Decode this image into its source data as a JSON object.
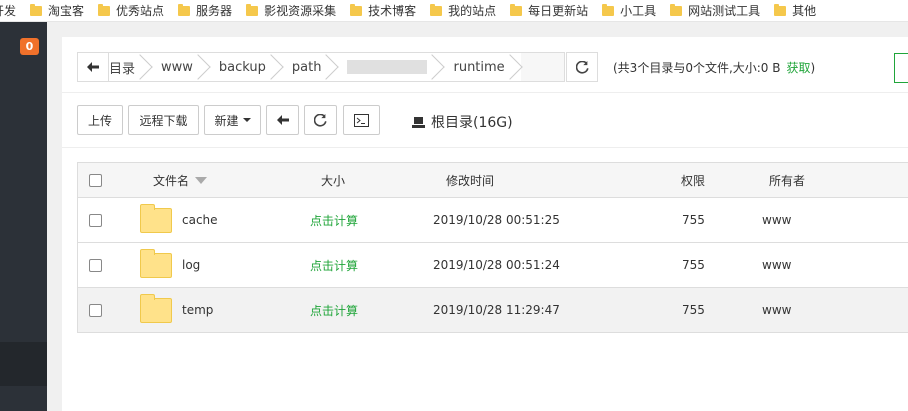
{
  "bookmarks": [
    "开发",
    "淘宝客",
    "优秀站点",
    "服务器",
    "影视资源采集",
    "技术博客",
    "我的站点",
    "每日更新站",
    "小工具",
    "网站测试工具",
    "其他"
  ],
  "sidebar": {
    "badge": "0"
  },
  "path": {
    "crumbs": [
      "目录",
      "www",
      "backup",
      "path",
      "runtime"
    ],
    "summary": "(共3个目录与0个文件,大小:0 B",
    "calc_link": "获取",
    "summary_close": ")"
  },
  "toolbar": {
    "upload": "上传",
    "remote_download": "远程下载",
    "new": "新建",
    "disk_label": "根目录(16G)"
  },
  "table": {
    "headers": {
      "name": "文件名",
      "size": "大小",
      "mtime": "修改时间",
      "perm": "权限",
      "owner": "所有者"
    },
    "rows": [
      {
        "name": "cache",
        "size": "点击计算",
        "mtime": "2019/10/28 00:51:25",
        "perm": "755",
        "owner": "www"
      },
      {
        "name": "log",
        "size": "点击计算",
        "mtime": "2019/10/28 00:51:24",
        "perm": "755",
        "owner": "www"
      },
      {
        "name": "temp",
        "size": "点击计算",
        "mtime": "2019/10/28 11:29:47",
        "perm": "755",
        "owner": "www"
      }
    ]
  },
  "colors": {
    "accent": "#20a53a",
    "sidebar": "#2c3138",
    "badge": "#f0712b"
  }
}
